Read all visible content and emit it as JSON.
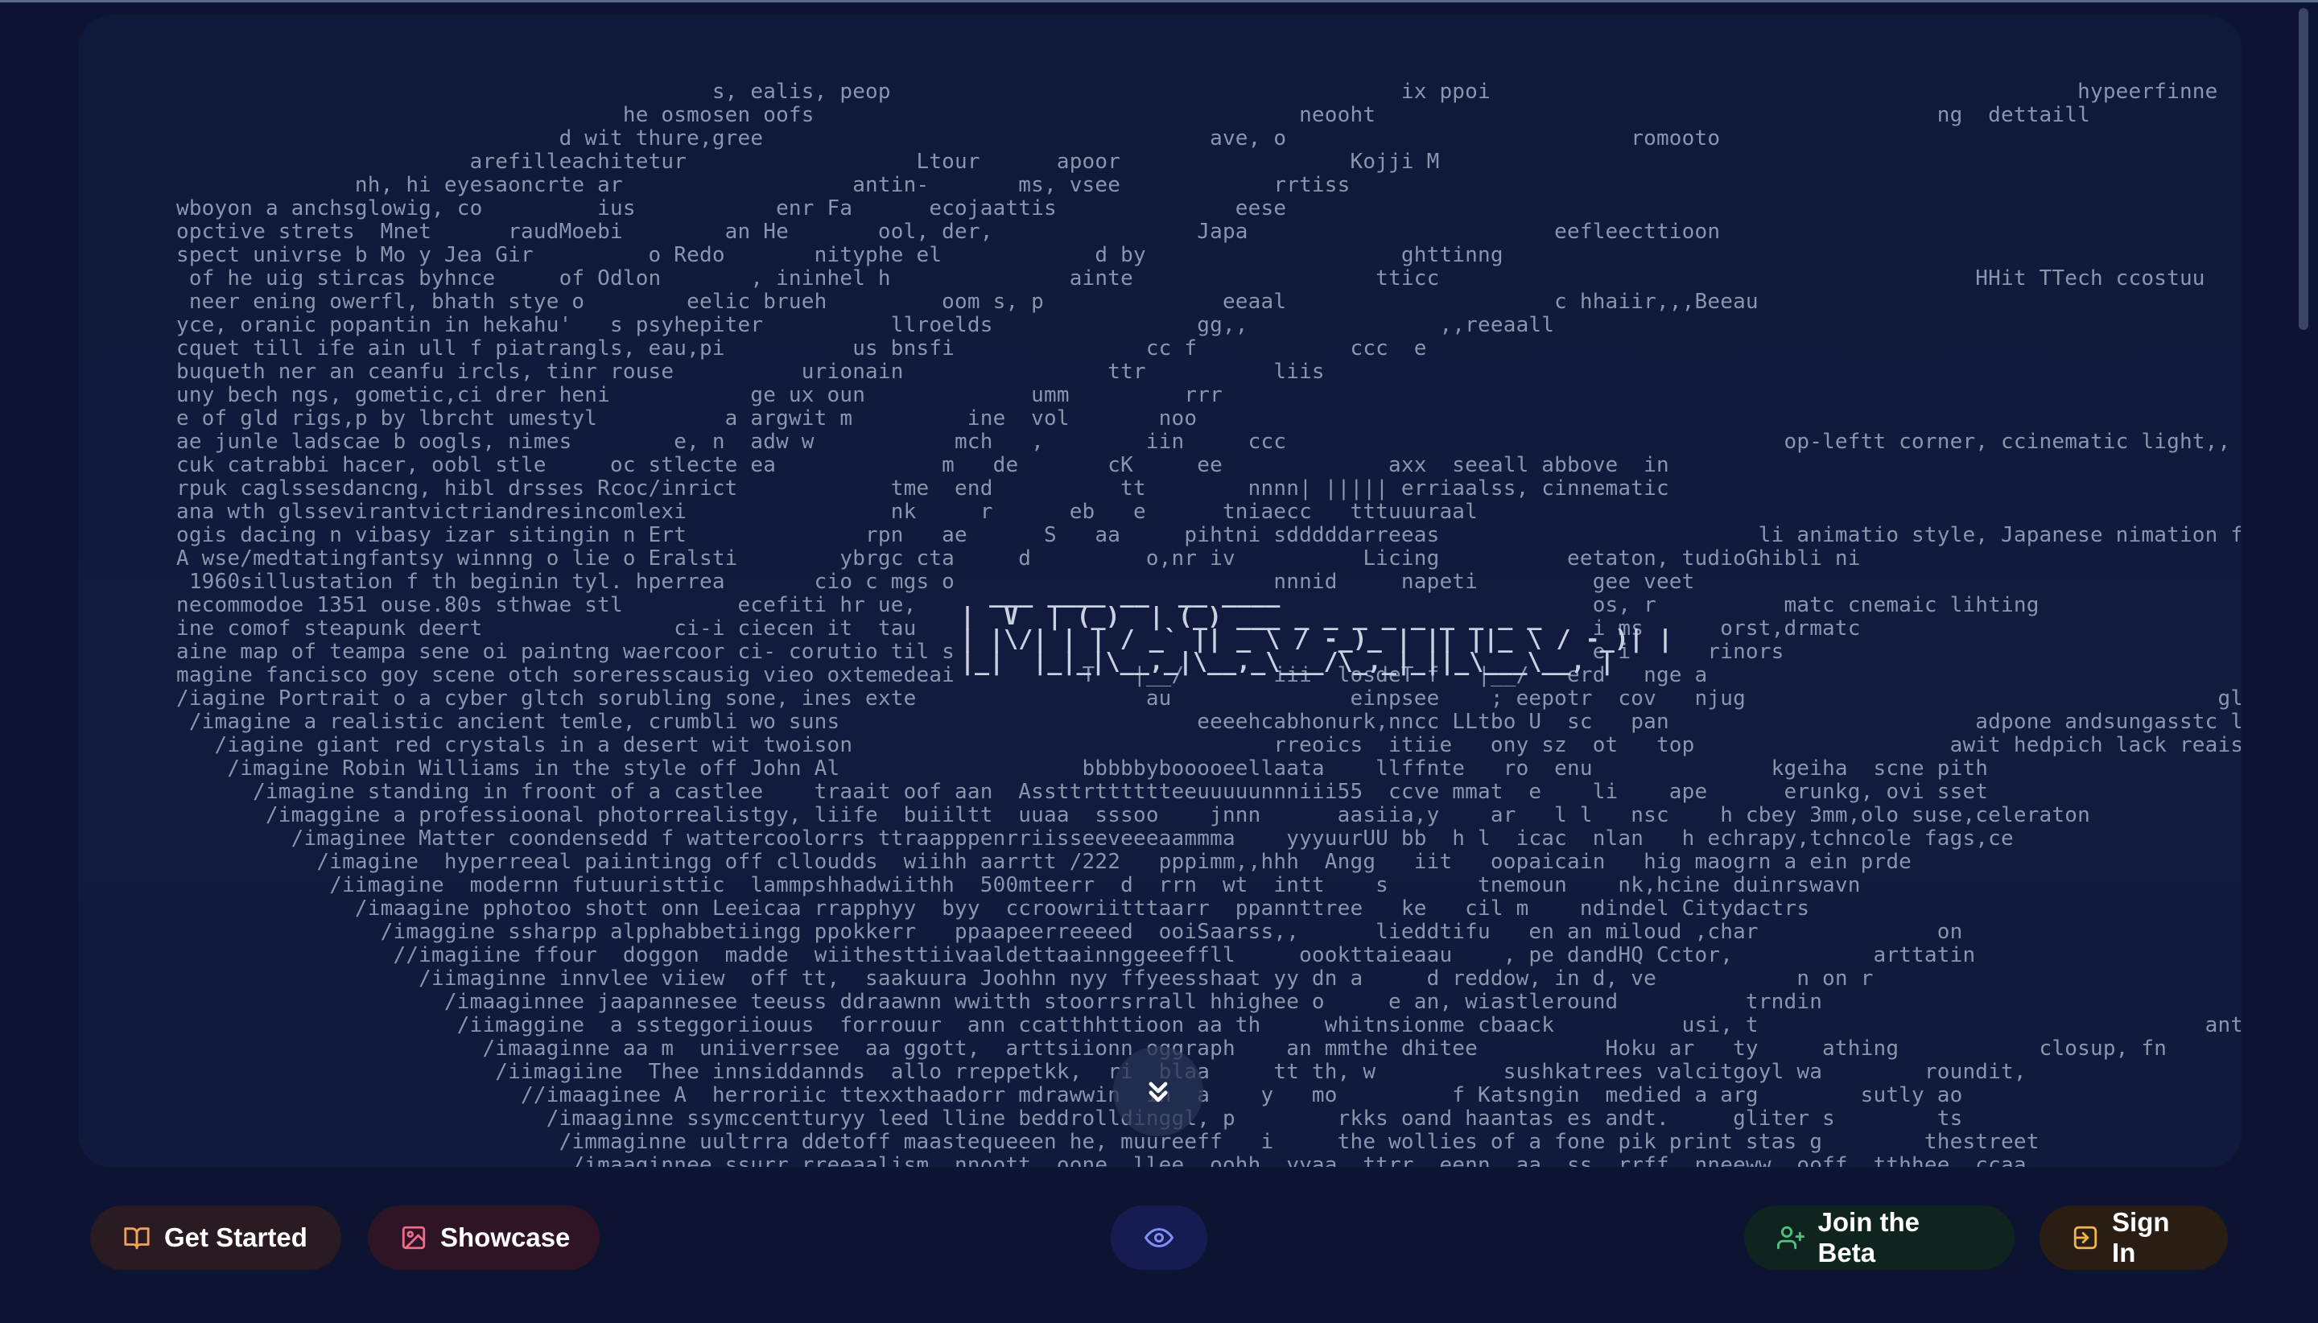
{
  "ascii_art": {
    "lines": [
      "                                                 s, ealis, peop                                        ix ppoi                                              hypeerfinne",
      "                                          he osmosen oofs                                      neooht                                            ng  dettaill",
      "                                     d wit thure,gree                                   ave, o                           romooto",
      "                              arefilleachitetur                  Ltour      apoor                  Kojji M",
      "                     nh, hi eyesaoncrte ar                  antin-       ms, vsee            rrtiss",
      "       wboyon a anchsglowig, co         ius           enr Fa      ecojaattis              eese",
      "       opctive strets  Mnet      raudMoebi        an He       ool, der,                Japa                        eefleecttioon",
      "       spect univrse b Mo y Jea Gir         o Redo       nityphe el            d by                    ghttinng",
      "        of he uig stircas byhnce     of Odlon       , ininhel h              ainte                   tticc                                          HHit TTech ccostuu",
      "        neer ening owerfl, bhath stye o        eelic brueh         oom s, p              eeaal                     c hhaiir,,,Beeau",
      "       yce, oranic popantin in hekahu'   s psyhepiter          llroelds                gg,,               ,,reeaall",
      "       cquet till ife ain ull f piatrangls, eau,pi          us bnsfi               cc f            ccc  e",
      "       buqueth ner an ceanfu ircls, tinr rouse          urionain                ttr          liis",
      "       uny bech ngs, gometic,ci drer heni           ge ux oun             umm         rrr",
      "       e of gld rigs,p by lbrcht umestyl          a argwit m         ine  vol       noo",
      "       ae junle ladscae b oogls, nimes        e, n  adw w           mch   ,        iin     ccc                                       op-leftt corner, ccinematic light,, artsta",
      "       cuk catrabbi hacer, oobl stle     oc stlecte ea             m   de       cK     ee             axx  seeall abbove  in",
      "       rpuk caglssesdancng, hibl drsses Rcoc/inrict            tme  end          tt        nnnn| ||||| erriaalss, cinnematic",
      "       ana wth glssevirantvictriandresincomlexi                nk     r      eb   e      tniaecc   tttuuuraal",
      "       ogis dacing n vibasy izar sitingin n Ert              rpn   ae      S   aa     pihtni sdddddarreeas                         li animatio style, Japanese nimation film",
      "       A wse/medtatingfantsy winnng o lie o Eralsti        ybrgc cta     d         o,nr iv          Licing          eetaton, tudioGhibli ni",
      "        1960sillustation f th beginin tyl. hperrea       cio c mgs o                         nnnid     napeti         gee veet",
      "       necommodoe 1351 ouse.80s sthwae stl         ecefiti hr ue,                                                     os, r          matc cnemaic lihting",
      "       ine comof steapunk deert               ci-i ciecen it  tau                                                     i ms      orst,drmatc",
      "       aine map of teampa sene oi paintng waercoor ci- corutio til s                                                  e i      rinors",
      "       magine fancisco goy scene otch soreresscausig vieo oxtemedeai          T   |__/       iii  losdeT f   |__/   erd   nge a",
      "       /iagine Portrait o a cyber gltch sorubling sone, ines exte                  au              einpsee    ; eepotr  cov   njug                                     glasss an VR gogles i s",
      "        /imagine a realistic ancient temle, crumbli wo suns                            eeeehcabhonurk,nncc LLtbo U  sc   pan                        adpone andsungasstc ligting,perspe",
      "          /iagine giant red crystals in a desert wit twoison                                 rreoics  itiie   ony sz  ot   top                    awit hedpich lack reaisti l",
      "           /imagine Robin Williams in the style off John Al                   bbbbbybooooeellaata    llffnte   ro  enu              kgeiha  scne pith",
      "             /imagine standing in froont of a castlee    traait oof aan  Assttrtttttteeuuuuunnniii55  ccve mmat  e    li    ape      erunkg, ovi sset",
      "              /imaggine a professioonal photorrealistgy, liife  buiiltt  uuaa  sssoo    jnnn      aasiia,y    ar   l l   nsc    h cbey 3mm,olo suse,celeraton",
      "                /imaginee Matter coondensedd f wattercoolorrs ttraapppenrriisseeveeeaammma    yyyuurUU bb  h l  icac  nlan   h echrapy,tchncole fags,ce",
      "                  /imagine  hyperreeal paiintingg off clloudds  wiihh aarrtt /222   pppimm,,hhh  Angg   iit   oopaicain   hig maogrn a ein prde",
      "                   /iimagine  modernn futuuristtic  lammpshhadwiithh  500mteerr  d  rrn  wt  intt    s       tnemoun    nk,hcine duinrswavn",
      "                     /imaagine pphotoo shott onn Leeicaa rrapphyy  byy  ccroowriitttaarr  ppannttree   ke   cil m    ndindel Citydactrs",
      "                       /imaggine ssharpp alpphabbetiingg ppokkerr   ppaapeerreeeed  ooiSaarss,,      lieddtifu   en an miloud ,char              on",
      "                        //imagiine ffour  doggon  madde  wiithesttiivaaldettaainnggeeeffll     oookttaieaau    , pe dandHQ Cctor,           arttatin",
      "                          /iimaginne innvlee viiew  off tt,  saakuura Joohhn nyy ffyeesshaat yy dn a     d reddow, in d, ve           n on r",
      "                            /imaaginnee jaapannesee teeuss ddraawnn wwitth stoorrsrrall hhighee o     e an, wiastleround          trndin                                    ame",
      "                             /iimaggine  a ssteggoriiouus  forrouur  ann ccatthhttioon aa th     whitnsionme cbaack          usi, t                                   antsy cad gam",
      "                               /imaaginne aa m  uniiverrsee  aa ggott,  arttsiionn oggraph    an mmthe dhitee          Hoku ar   ty     athing           closup, fn",
      "                                /iimagiine  Thee innsiddannds  allo rreppetkk,  ri  blaa     tt th, w          sushkatrees valcitgoyl wa        roundit,",
      "                                  //imaaginee A  herroriic ttexxthaadorr mdrawwin  in  a    y   mo         f Katsngin  medied a arg        sutly ao",
      "                                    /imaaginne ssymccentturyy leed lline beddrolldinggl, p        rkks oand haantas es andt.     gliter s        ts",
      "                                     /immaginne uultrra ddetoff maastequeeen he, muureeff   i     the wollies of a fone pik print stas g        thestreet",
      "                                      /imaaginnee ssurr rreeaalism  nnoott  oone  llee  oohh  yyaa  ttrr  eenn  aa  ss  rrff  nneeww  ooff  tthhee  ccaa"
    ],
    "logo_lines": [
      "  ___ ____ __  __ ____",
      "|  V  | (_)  | (_) ___ _ _ _ _ _ _ _ _ _",
      "| |\\/| | | / _` || _ \\ / -_)_ | || ||_ \\ / -_)| |",
      "|_|  |_|_|\\__,_|\\__,_\\___/\\_,_|_||_\\___\\__, |"
    ]
  },
  "buttons": {
    "get_started": "Get Started",
    "showcase": "Showcase",
    "join_beta": "Join the Beta",
    "sign_in": "Sign In"
  },
  "colors": {
    "background": "#0c1431",
    "panel": "#101a3d",
    "ascii_text": "#8a94ad",
    "get_started_icon": "#f2a25a",
    "showcase_icon": "#f06a8a",
    "eye_icon": "#7d8ff5",
    "join_beta_icon": "#4ec27e",
    "sign_in_icon": "#f0b44a"
  },
  "icons": {
    "get_started": "book-open-icon",
    "showcase": "image-icon",
    "eye": "eye-icon",
    "join_beta": "user-plus-icon",
    "sign_in": "sign-in-icon",
    "scroll": "chevrons-down-icon"
  }
}
